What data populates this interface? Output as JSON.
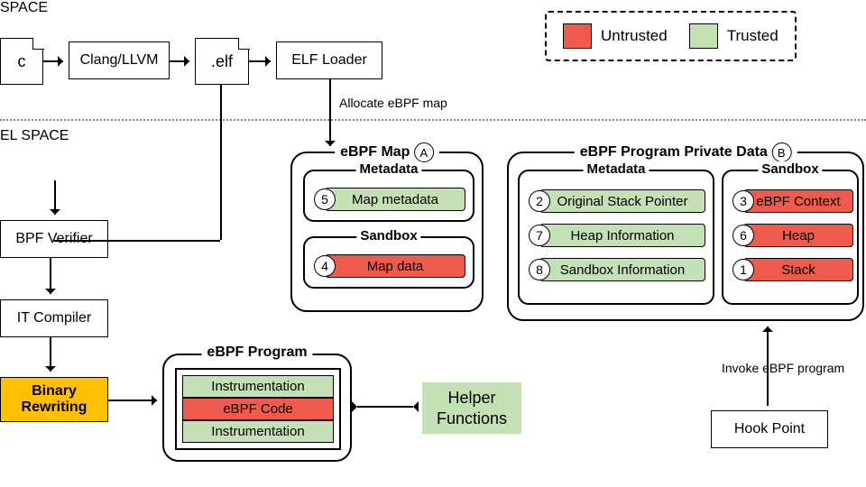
{
  "regions": {
    "user": "SPACE",
    "kernel": "EL SPACE"
  },
  "legend": {
    "untrusted": "Untrusted",
    "trusted": "Trusted"
  },
  "colors": {
    "untrusted": "#ee5a4b",
    "trusted": "#c4e1b5",
    "highlight": "#ffc000"
  },
  "pipeline": {
    "src": "c",
    "compiler": "Clang/LLVM",
    "obj": ".elf",
    "loader": "ELF Loader",
    "verifier": "BPF Verifier",
    "jit": "IT Compiler",
    "rewrite": "Binary\nRewriting"
  },
  "notes": {
    "allocate": "Allocate eBPF map",
    "invoke": "Invoke eBPF program"
  },
  "ebpf_map": {
    "title": "eBPF Map",
    "badge": "A",
    "metadata_label": "Metadata",
    "sandbox_label": "Sandbox",
    "items": {
      "meta": {
        "n": "5",
        "label": "Map metadata",
        "trust": "trusted"
      },
      "data": {
        "n": "4",
        "label": "Map data",
        "trust": "untrusted"
      }
    }
  },
  "priv": {
    "title": "eBPF Program Private Data",
    "badge": "B",
    "metadata_label": "Metadata",
    "sandbox_label": "Sandbox",
    "metadata": [
      {
        "n": "2",
        "label": "Original Stack Pointer",
        "trust": "trusted"
      },
      {
        "n": "7",
        "label": "Heap Information",
        "trust": "trusted"
      },
      {
        "n": "8",
        "label": "Sandbox Information",
        "trust": "trusted"
      }
    ],
    "sandbox": [
      {
        "n": "3",
        "label": "eBPF Context",
        "trust": "untrusted"
      },
      {
        "n": "6",
        "label": "Heap",
        "trust": "untrusted"
      },
      {
        "n": "1",
        "label": "Stack",
        "trust": "untrusted"
      }
    ]
  },
  "prog": {
    "title": "eBPF Program",
    "rows": [
      "Instrumentation",
      "eBPF Code",
      "Instrumentation"
    ],
    "row_trust": [
      "trusted",
      "untrusted",
      "trusted"
    ]
  },
  "helper": "Helper\nFunctions",
  "hook": "Hook Point"
}
